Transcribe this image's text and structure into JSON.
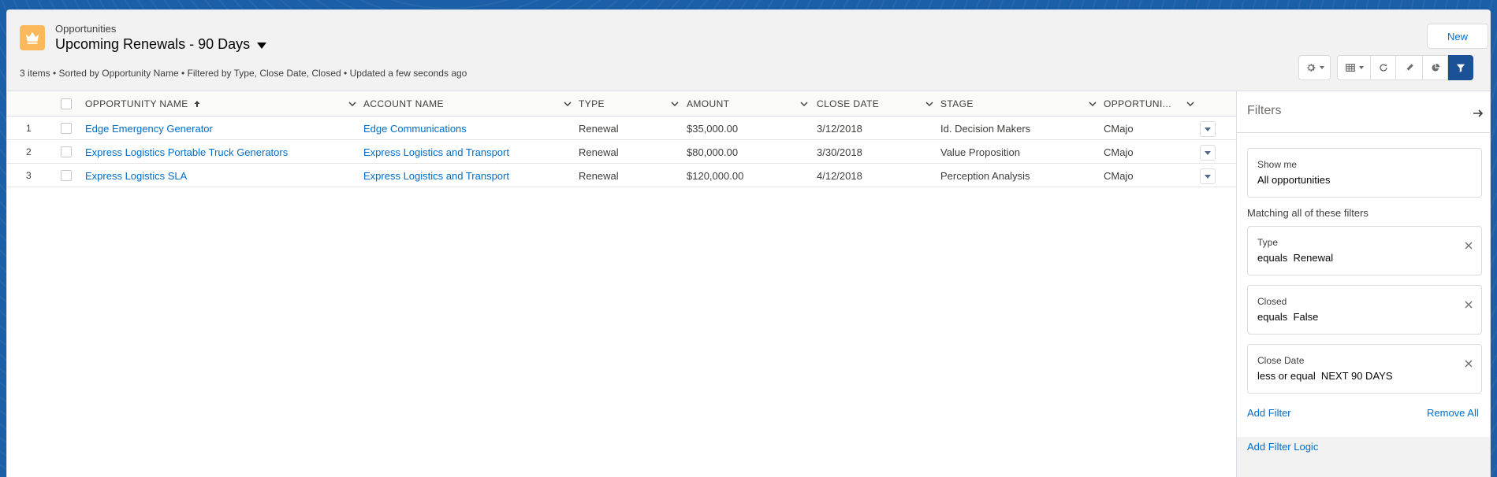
{
  "header": {
    "object_label": "Opportunities",
    "list_title": "Upcoming Renewals - 90 Days",
    "summary": "3 items • Sorted by Opportunity Name • Filtered by Type, Close Date, Closed • Updated a few seconds ago",
    "new_label": "New"
  },
  "colors": {
    "accent": "#0070d2",
    "link": "#006dcc",
    "object_icon": "#fcb95b",
    "active_button": "#1b5297",
    "background": "#1b5fa8"
  },
  "toolbar": {
    "icons": [
      "gear-icon",
      "table-view-icon",
      "refresh-icon",
      "pencil-icon",
      "pie-chart-icon",
      "filter-icon"
    ]
  },
  "table": {
    "columns": [
      "Opportunity Name",
      "Account Name",
      "Type",
      "Amount",
      "Close Date",
      "Stage",
      "Opportuni..."
    ],
    "rows": [
      {
        "num": "1",
        "name": "Edge Emergency Generator",
        "account": "Edge Communications",
        "type": "Renewal",
        "amount": "$35,000.00",
        "close_date": "3/12/2018",
        "stage": "Id. Decision Makers",
        "owner": "CMajo"
      },
      {
        "num": "2",
        "name": "Express Logistics Portable Truck Generators",
        "account": "Express Logistics and Transport",
        "type": "Renewal",
        "amount": "$80,000.00",
        "close_date": "3/30/2018",
        "stage": "Value Proposition",
        "owner": "CMajo"
      },
      {
        "num": "3",
        "name": "Express Logistics SLA",
        "account": "Express Logistics and Transport",
        "type": "Renewal",
        "amount": "$120,000.00",
        "close_date": "4/12/2018",
        "stage": "Perception Analysis",
        "owner": "CMajo"
      }
    ]
  },
  "filters": {
    "title": "Filters",
    "show_me": {
      "label": "Show me",
      "value": "All opportunities"
    },
    "matching_label": "Matching all of these filters",
    "items": [
      {
        "label": "Type",
        "value": "equals  Renewal"
      },
      {
        "label": "Closed",
        "value": "equals  False"
      },
      {
        "label": "Close Date",
        "value": "less or equal  NEXT 90 DAYS"
      }
    ],
    "add_filter": "Add Filter",
    "remove_all": "Remove All",
    "add_filter_logic": "Add Filter Logic"
  }
}
